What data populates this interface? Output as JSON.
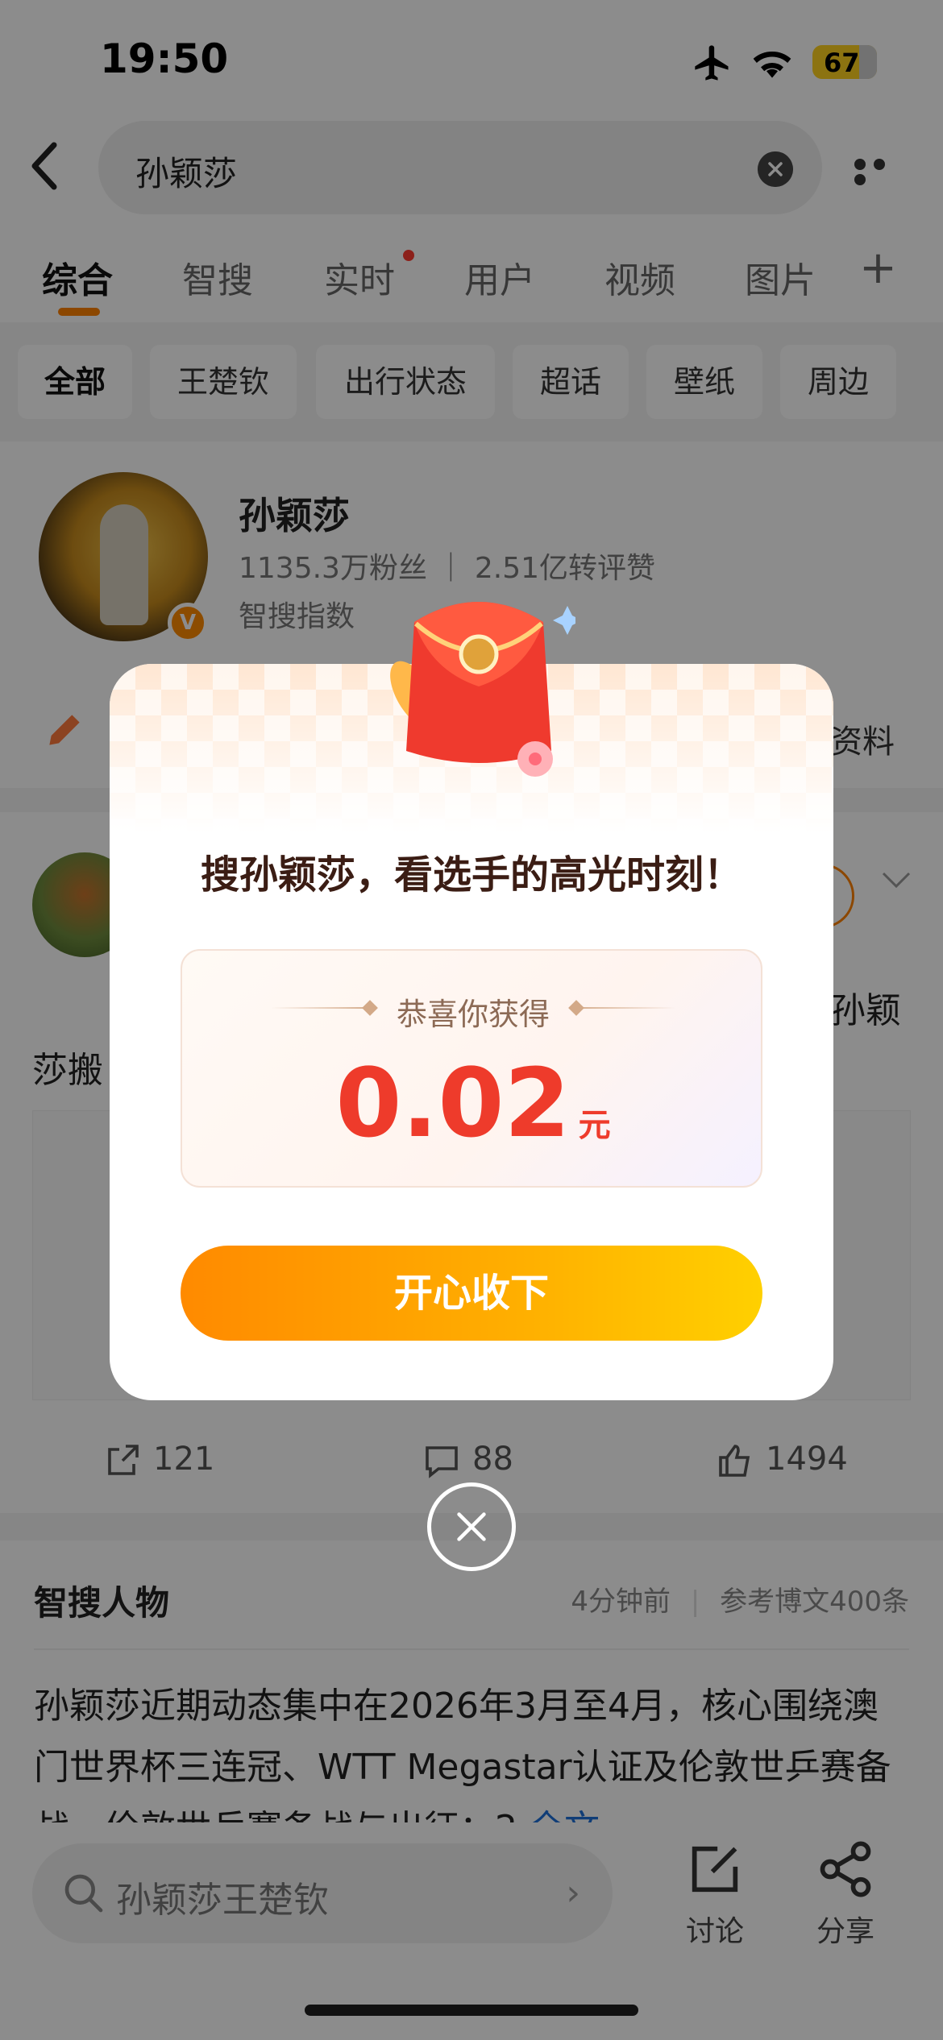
{
  "status_bar": {
    "time": "19:50",
    "battery": "67"
  },
  "search": {
    "query": "孙颖莎"
  },
  "tabs": [
    {
      "label": "综合"
    },
    {
      "label": "智搜"
    },
    {
      "label": "实时"
    },
    {
      "label": "用户"
    },
    {
      "label": "视频"
    },
    {
      "label": "图片"
    }
  ],
  "chips": [
    {
      "label": "全部"
    },
    {
      "label": "王楚钦"
    },
    {
      "label": "出行状态"
    },
    {
      "label": "超话"
    },
    {
      "label": "壁纸"
    },
    {
      "label": "周边"
    }
  ],
  "profile": {
    "name": "孙颖莎",
    "stats": "1135.3万粉丝 ｜ 2.51亿转评赞",
    "index_partial": "智搜指数",
    "more_partial": "资料"
  },
  "post": {
    "text_line1_partial": "孙颖",
    "text_line2_partial": "莎搬",
    "shares": "121",
    "comments": "88",
    "likes": "1494"
  },
  "zhisou": {
    "title": "智搜人物",
    "time": "4分钟前",
    "refs": "参考博文400条",
    "body": "孙颖莎近期动态集中在2026年3月至4月，核心围绕澳门世界杯三连冠、WTT Megastar认证及伦敦世乒赛备战，伦敦世乒赛备战与出征：2",
    "more": "全文"
  },
  "bottom_bar": {
    "search_hint": "孙颖莎王楚钦",
    "discuss_label": "讨论",
    "share_label": "分享"
  },
  "modal": {
    "headline": "搜孙颖莎，看选手的高光时刻！",
    "congrats": "恭喜你获得",
    "amount": "0.02",
    "unit": "元",
    "accept_label": "开心收下"
  },
  "colors": {
    "accent_orange": "#ff8200",
    "amount_red": "#ee3b2b",
    "button_gradient_start": "#ff8a00",
    "button_gradient_end": "#ffd000"
  }
}
